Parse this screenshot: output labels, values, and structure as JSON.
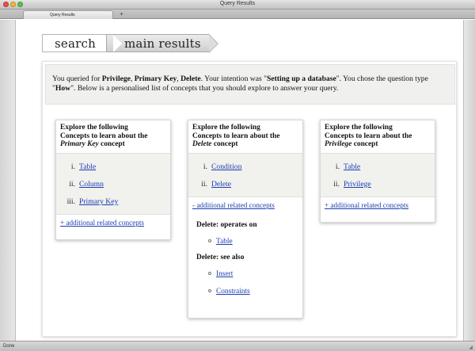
{
  "window": {
    "title": "Query Results"
  },
  "tabs": [
    {
      "label": "Query Results"
    }
  ],
  "tab_new_label": "+",
  "status_bar": {
    "text": "Done"
  },
  "breadcrumb": [
    {
      "label": "search",
      "active": false
    },
    {
      "label": "main results",
      "active": true
    }
  ],
  "summary": {
    "t1": "You queried for ",
    "k1": "Privilege",
    "t2": ", ",
    "k2": "Primary Key",
    "t3": ", ",
    "k3": "Delete",
    "t4": ". Your intention was \"",
    "intention": "Setting up a database",
    "t5": "\". You chose the question type \"",
    "qtype": "How",
    "t6": "\". Below is a personalised list of concepts that you should explore to answer your query."
  },
  "cards": [
    {
      "head_line1": "Explore the following",
      "head_line2": "Concepts to learn about the",
      "head_concept": "Primary Key",
      "head_tail": " concept",
      "items": [
        {
          "num": "i.",
          "label": "Table"
        },
        {
          "num": "ii.",
          "label": "Column"
        },
        {
          "num": "iii.",
          "label": "Primary Key"
        }
      ],
      "more_label": "+ additional related concepts"
    },
    {
      "head_line1": "Explore the following",
      "head_line2": "Concepts to learn about the",
      "head_concept": "Delete",
      "head_tail": " concept",
      "items": [
        {
          "num": "i.",
          "label": "Condition"
        },
        {
          "num": "ii.",
          "label": "Delete"
        }
      ],
      "more_label": "- additional related concepts",
      "related": [
        {
          "heading": "Delete: operates on",
          "links": [
            "Table"
          ]
        },
        {
          "heading": "Delete: see also",
          "links": [
            "Insert",
            "Constraints"
          ]
        }
      ]
    },
    {
      "head_line1": "Explore the following",
      "head_line2": "Concepts to learn about the",
      "head_concept": "Privilege",
      "head_tail": " concept",
      "items": [
        {
          "num": "i.",
          "label": "Table"
        },
        {
          "num": "ii.",
          "label": "Privilege"
        }
      ],
      "more_label": "+ additional related concepts"
    }
  ]
}
